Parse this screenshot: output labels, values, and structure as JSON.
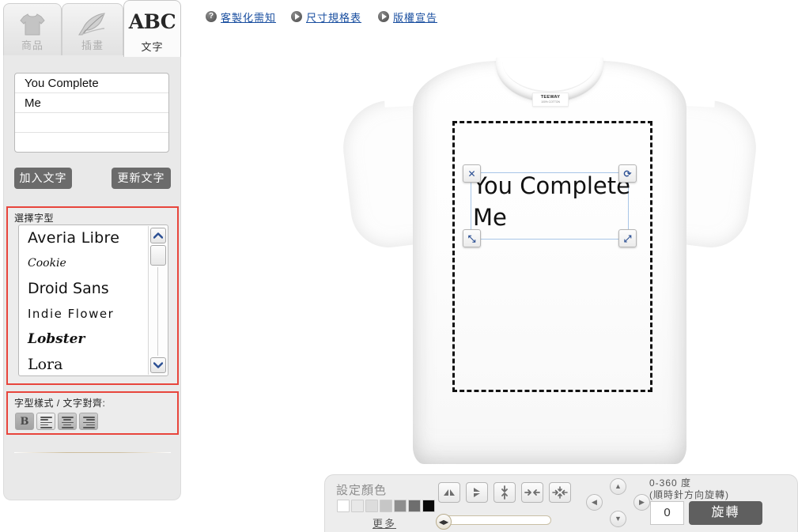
{
  "tabs": [
    {
      "id": "product",
      "label": "商品",
      "icon": "tshirt-icon",
      "active": false
    },
    {
      "id": "art",
      "label": "插畫",
      "icon": "feather-icon",
      "active": false
    },
    {
      "id": "text",
      "label": "文字",
      "icon": "abc-icon",
      "active": true
    }
  ],
  "abc_mark": "ABC",
  "top_links": [
    {
      "id": "notice",
      "label": "客製化需知",
      "icon": "question-mark-icon"
    },
    {
      "id": "size",
      "label": "尺寸規格表",
      "icon": "play-triangle-icon"
    },
    {
      "id": "copyright",
      "label": "版權宣告",
      "icon": "play-triangle-icon"
    }
  ],
  "text_input": {
    "lines": [
      "You Complete",
      "Me",
      "",
      ""
    ],
    "placeholder": ""
  },
  "buttons": {
    "add_text": "加入文字",
    "update_text": "更新文字"
  },
  "font_panel": {
    "title": "選擇字型",
    "fonts": [
      {
        "name": "Averia Libre",
        "style": "f-averia"
      },
      {
        "name": "Cookie",
        "style": "f-cookie"
      },
      {
        "name": "Droid Sans",
        "style": "f-droid"
      },
      {
        "name": "Indie Flower",
        "style": "f-indie"
      },
      {
        "name": "Lobster",
        "style": "f-lobster"
      },
      {
        "name": "Lora",
        "style": "f-lora"
      }
    ],
    "accent_color": "#e8453c"
  },
  "style_panel": {
    "title": "字型樣式 / 文字對齊:",
    "bold_label": "B",
    "buttons": [
      "bold",
      "align-left",
      "align-center",
      "align-right"
    ],
    "accent_color": "#e8453c"
  },
  "shirt": {
    "color": "#ffffff",
    "neck_brand": "TEEWAY",
    "neck_sub": "100% COTTON"
  },
  "design": {
    "text": "You Complete\nMe",
    "handles": {
      "top_left": "✕",
      "top_right": "⟳",
      "bottom_left": "⤡",
      "bottom_right": "⤢"
    }
  },
  "toolbar": {
    "color_title": "設定顏色",
    "swatches": [
      "#ffffff",
      "#e8e8e8",
      "#dcdcdc",
      "#c6c6c6",
      "#8e8e8e",
      "#6e6e6e",
      "#0a0a0a"
    ],
    "more_link": "更多",
    "transform_buttons": [
      {
        "id": "flip-horizontal",
        "icon": "flip-horizontal-icon"
      },
      {
        "id": "flip-vertical",
        "icon": "flip-vertical-icon"
      },
      {
        "id": "center-vertical",
        "icon": "center-vertical-icon"
      },
      {
        "id": "center-horizontal",
        "icon": "center-horizontal-icon"
      },
      {
        "id": "center-both",
        "icon": "center-both-icon"
      }
    ],
    "slider_value": 0,
    "dpad": {
      "up": "▲",
      "down": "▼",
      "left": "◀",
      "right": "▶"
    },
    "rotate_label_line1": "0-360 度",
    "rotate_label_line2": "(順時針方向旋轉)",
    "rotate_value": "0",
    "rotate_button": "旋轉"
  }
}
